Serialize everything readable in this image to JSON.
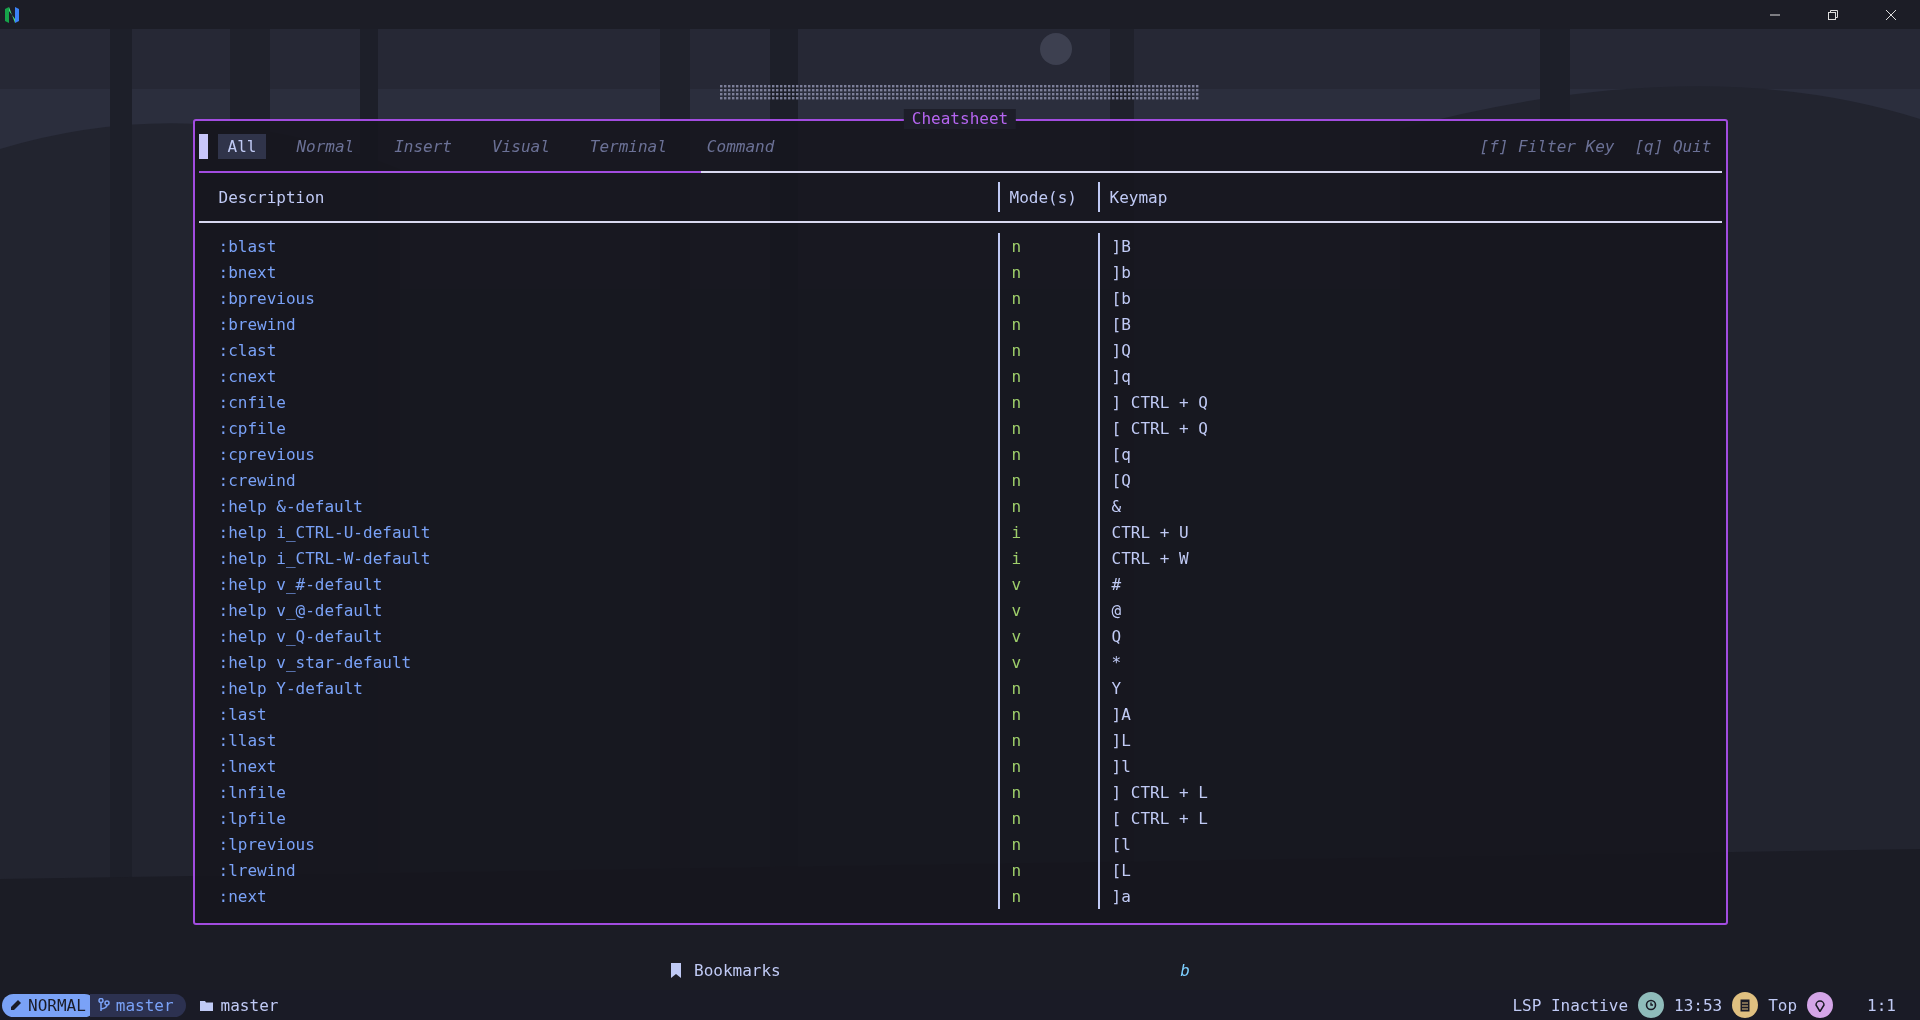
{
  "popup": {
    "title": "Cheatsheet",
    "tabs": [
      {
        "label": "All",
        "selected": true
      },
      {
        "label": "Normal",
        "selected": false
      },
      {
        "label": "Insert",
        "selected": false
      },
      {
        "label": "Visual",
        "selected": false
      },
      {
        "label": "Terminal",
        "selected": false
      },
      {
        "label": "Command",
        "selected": false
      }
    ],
    "hints": [
      "[f] Filter Key",
      "[q] Quit"
    ],
    "columns": [
      "Description",
      "Mode(s)",
      "Keymap"
    ],
    "rows": [
      {
        "description": ":blast",
        "mode": "n",
        "keymap": "]B"
      },
      {
        "description": ":bnext",
        "mode": "n",
        "keymap": "]b"
      },
      {
        "description": ":bprevious",
        "mode": "n",
        "keymap": "[b"
      },
      {
        "description": ":brewind",
        "mode": "n",
        "keymap": "[B"
      },
      {
        "description": ":clast",
        "mode": "n",
        "keymap": "]Q"
      },
      {
        "description": ":cnext",
        "mode": "n",
        "keymap": "]q"
      },
      {
        "description": ":cnfile",
        "mode": "n",
        "keymap": "] CTRL + Q"
      },
      {
        "description": ":cpfile",
        "mode": "n",
        "keymap": "[ CTRL + Q"
      },
      {
        "description": ":cprevious",
        "mode": "n",
        "keymap": "[q"
      },
      {
        "description": ":crewind",
        "mode": "n",
        "keymap": "[Q"
      },
      {
        "description": ":help &-default",
        "mode": "n",
        "keymap": "&"
      },
      {
        "description": ":help i_CTRL-U-default",
        "mode": "i",
        "keymap": "CTRL + U"
      },
      {
        "description": ":help i_CTRL-W-default",
        "mode": "i",
        "keymap": "CTRL + W"
      },
      {
        "description": ":help v_#-default",
        "mode": "v",
        "keymap": "#"
      },
      {
        "description": ":help v_@-default",
        "mode": "v",
        "keymap": "@"
      },
      {
        "description": ":help v_Q-default",
        "mode": "v",
        "keymap": "Q"
      },
      {
        "description": ":help v_star-default",
        "mode": "v",
        "keymap": "*"
      },
      {
        "description": ":help Y-default",
        "mode": "n",
        "keymap": "Y"
      },
      {
        "description": ":last",
        "mode": "n",
        "keymap": "]A"
      },
      {
        "description": ":llast",
        "mode": "n",
        "keymap": "]L"
      },
      {
        "description": ":lnext",
        "mode": "n",
        "keymap": "]l"
      },
      {
        "description": ":lnfile",
        "mode": "n",
        "keymap": "] CTRL + L"
      },
      {
        "description": ":lpfile",
        "mode": "n",
        "keymap": "[ CTRL + L"
      },
      {
        "description": ":lprevious",
        "mode": "n",
        "keymap": "[l"
      },
      {
        "description": ":lrewind",
        "mode": "n",
        "keymap": "[L"
      },
      {
        "description": ":next",
        "mode": "n",
        "keymap": "]a"
      }
    ]
  },
  "dashboard": {
    "label": "Bookmarks",
    "key": "b"
  },
  "status_bar": {
    "mode": "NORMAL",
    "branch": "master",
    "directory": "master",
    "lsp": "LSP Inactive",
    "time": "13:53",
    "scroll": "Top",
    "cursor": "1:1"
  }
}
